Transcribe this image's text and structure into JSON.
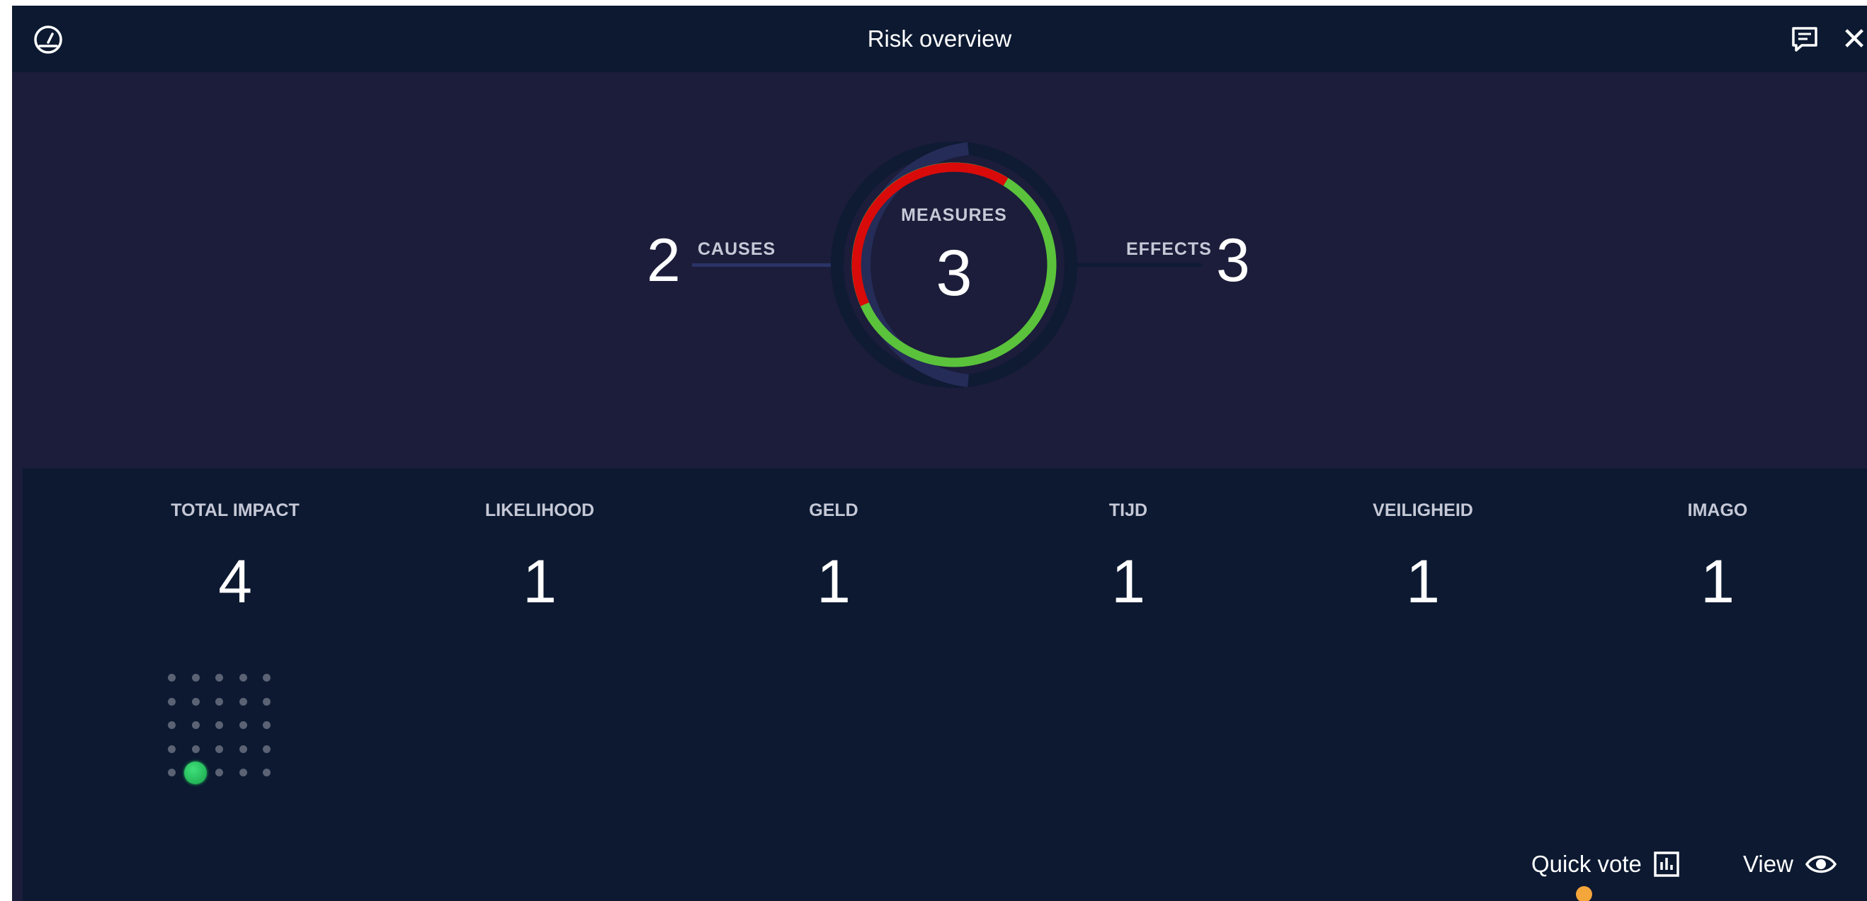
{
  "header": {
    "title": "Risk overview",
    "left_icon": "gauge-icon",
    "comment_icon": "comment-icon",
    "close_label": "✕"
  },
  "overview": {
    "causes": {
      "value": "2",
      "label": "CAUSES"
    },
    "effects": {
      "value": "3",
      "label": "EFFECTS"
    },
    "measures": {
      "value": "3",
      "label": "MEASURES"
    },
    "colors": {
      "good": "#5bc23b",
      "bad": "#d90a0a",
      "ring_track": "#252c58",
      "ring_dark": "#0f1a33"
    }
  },
  "metrics": [
    {
      "label": "TOTAL IMPACT",
      "value": "4"
    },
    {
      "label": "LIKELIHOOD",
      "value": "1"
    },
    {
      "label": "GELD",
      "value": "1"
    },
    {
      "label": "TIJD",
      "value": "1"
    },
    {
      "label": "VEILIGHEID",
      "value": "1"
    },
    {
      "label": "IMAGO",
      "value": "1"
    }
  ],
  "risk_matrix": {
    "rows": 5,
    "cols": 5,
    "active": {
      "row": 5,
      "col": 2
    },
    "active_color": "#22c55e"
  },
  "actions": {
    "quick_vote": "Quick vote",
    "quick_vote_icon": "bar-chart-icon",
    "view": "View",
    "view_icon": "eye-icon",
    "notification_color": "#f5a63a"
  }
}
